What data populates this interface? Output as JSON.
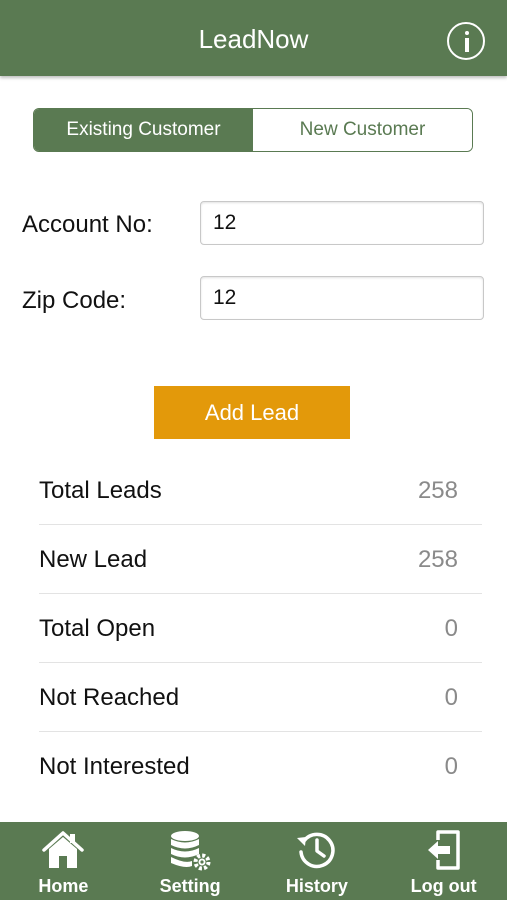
{
  "header": {
    "title": "LeadNow",
    "info_icon": "info-icon"
  },
  "segment": {
    "existing": "Existing Customer",
    "new": "New Customer",
    "selected": "existing"
  },
  "form": {
    "account_label": "Account No:",
    "account_value": "12",
    "zip_label": "Zip Code:",
    "zip_value": "12"
  },
  "add_button": "Add Lead",
  "stats": [
    {
      "label": "Total Leads",
      "value": "258"
    },
    {
      "label": "New Lead",
      "value": "258"
    },
    {
      "label": "Total Open",
      "value": "0"
    },
    {
      "label": "Not Reached",
      "value": "0"
    },
    {
      "label": "Not Interested",
      "value": "0"
    }
  ],
  "tabs": [
    {
      "label": "Home",
      "icon": "home-icon"
    },
    {
      "label": "Setting",
      "icon": "database-gear-icon"
    },
    {
      "label": "History",
      "icon": "history-icon"
    },
    {
      "label": "Log out",
      "icon": "logout-icon"
    }
  ],
  "colors": {
    "primary": "#5a7a52",
    "accent": "#e3990a"
  }
}
